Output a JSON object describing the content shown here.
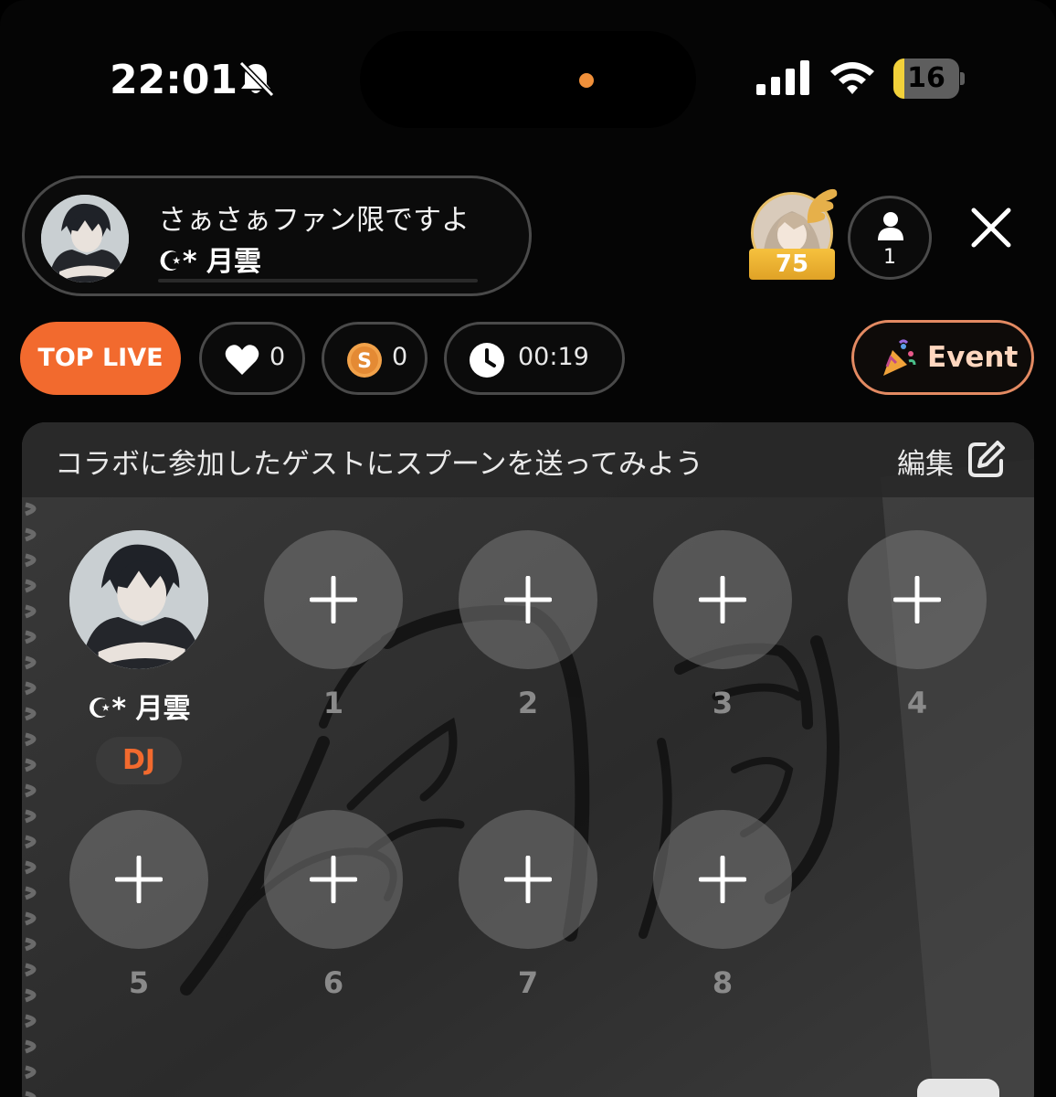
{
  "status_bar": {
    "time": "22:01",
    "battery": "16",
    "battery_level": 0.16
  },
  "host": {
    "title": "さぁさぁファン限ですよ",
    "name": "☪︎* 月雲"
  },
  "fan": {
    "level": "75"
  },
  "listeners": {
    "count": "1"
  },
  "stats": {
    "top_live": "TOP LIVE",
    "likes": "0",
    "spoons": "0",
    "duration": "00:19"
  },
  "event": {
    "label": "Event"
  },
  "stage": {
    "banner": "コラボに参加したゲストにスプーンを送ってみよう",
    "edit": "編集",
    "dj": {
      "name": "☪︎* 月雲",
      "badge": "DJ"
    },
    "slots": [
      "1",
      "2",
      "3",
      "4",
      "5",
      "6",
      "7",
      "8"
    ]
  },
  "colors": {
    "accent": "#f26a2e",
    "gold": "#f6c13e",
    "battery_yellow": "#f2d13a"
  }
}
